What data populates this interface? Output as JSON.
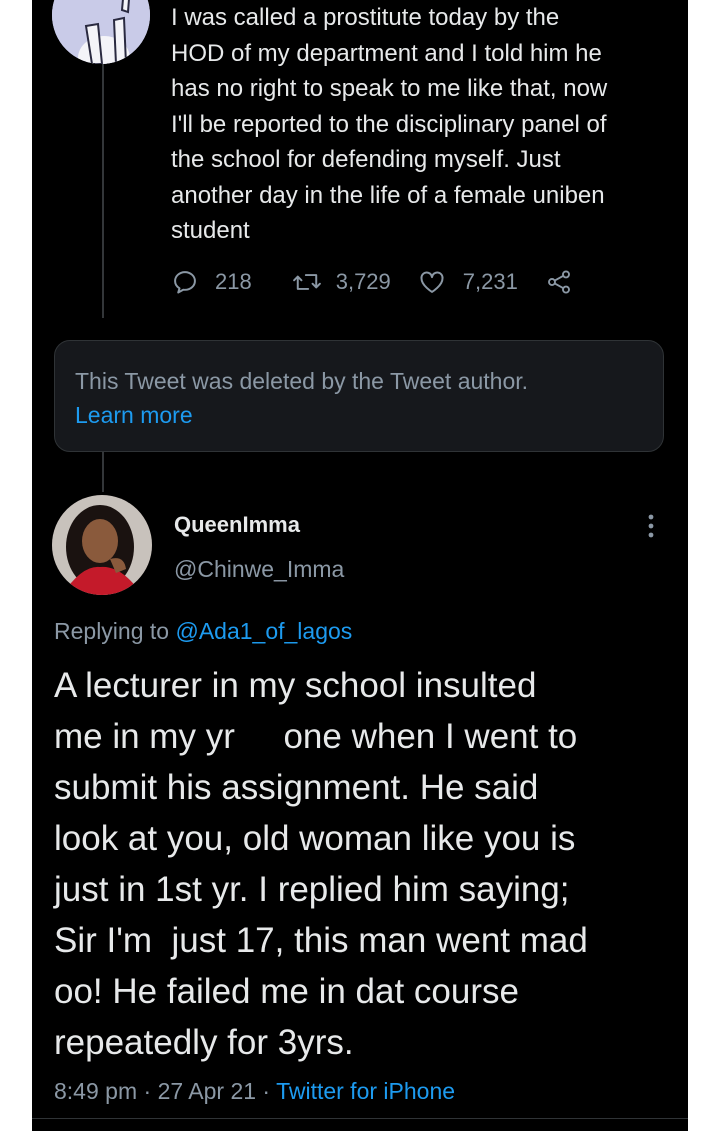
{
  "tweet_top": {
    "text": "I was called a prostitute today by the\nHOD of my department and I told him he\nhas no right to speak to me like that, now\nI'll be reported to the disciplinary panel of\nthe school for defending myself. Just\nanother day in the life of a female uniben\nstudent",
    "replies": "218",
    "retweets": "3,729",
    "likes": "7,231",
    "icons": [
      "reply-icon",
      "retweet-icon",
      "like-icon",
      "share-icon"
    ]
  },
  "deleted_notice": {
    "text": "This Tweet was deleted by the Tweet author.",
    "link": "Learn more"
  },
  "reply_tweet": {
    "display_name": "QueenImma",
    "handle": "@Chinwe_Imma",
    "replying_prefix": "Replying to ",
    "replying_to": "@Ada1_of_lagos",
    "text": "A lecturer in my school insulted\nme in my yr     one when I went to\nsubmit his assignment. He said\nlook at you, old woman like you is\njust in 1st yr. I replied him saying;\nSir I'm  just 17, this man went mad\noo! He failed me in dat course\nrepeatedly for 3yrs.",
    "time": "8:49 pm",
    "separator": " · ",
    "date": "27 Apr 21",
    "client": "Twitter for iPhone"
  },
  "colors": {
    "background": "#000000",
    "text": "#e7e9ea",
    "muted": "#8b98a5",
    "accent": "#1d9bf0"
  }
}
